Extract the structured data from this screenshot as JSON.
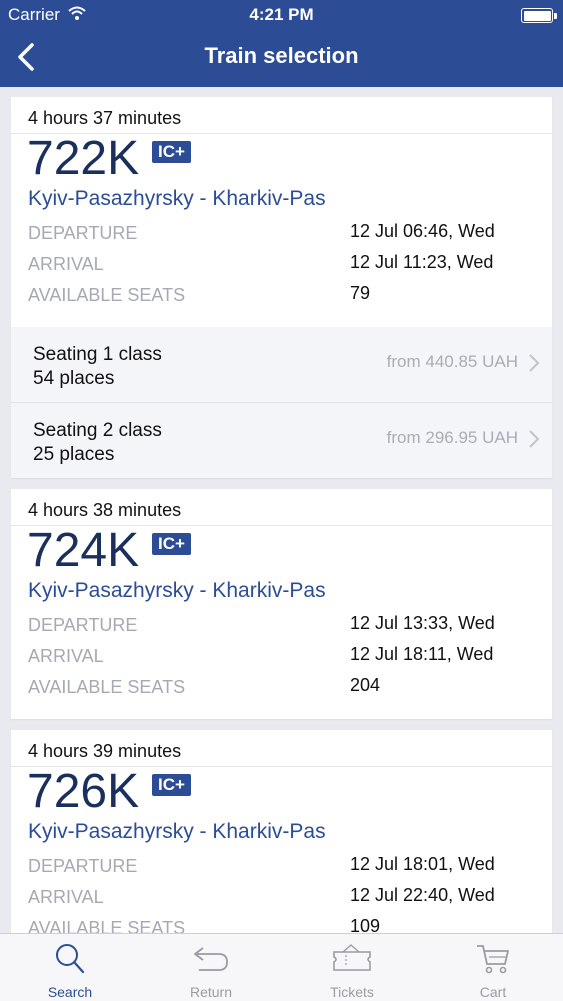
{
  "status_bar": {
    "carrier": "Carrier",
    "time": "4:21 PM"
  },
  "nav": {
    "title": "Train selection"
  },
  "trains": [
    {
      "duration": "4 hours 37 minutes",
      "number": "722K",
      "badge": "IC+",
      "route": "Kyiv-Pasazhyrsky - Kharkiv-Pas",
      "departure_label": "DEPARTURE",
      "departure": "12 Jul 06:46, Wed",
      "arrival_label": "ARRIVAL",
      "arrival": "12 Jul 11:23, Wed",
      "seats_label": "AVAILABLE SEATS",
      "seats": "79",
      "classes": [
        {
          "name": "Seating 1 class",
          "places": "54 places",
          "price": "from 440.85 UAH"
        },
        {
          "name": "Seating 2 class",
          "places": "25 places",
          "price": "from 296.95 UAH"
        }
      ]
    },
    {
      "duration": "4 hours 38 minutes",
      "number": "724K",
      "badge": "IC+",
      "route": "Kyiv-Pasazhyrsky - Kharkiv-Pas",
      "departure_label": "DEPARTURE",
      "departure": "12 Jul 13:33, Wed",
      "arrival_label": "ARRIVAL",
      "arrival": "12 Jul 18:11, Wed",
      "seats_label": "AVAILABLE SEATS",
      "seats": "204"
    },
    {
      "duration": "4 hours 39 minutes",
      "number": "726K",
      "badge": "IC+",
      "route": "Kyiv-Pasazhyrsky - Kharkiv-Pas",
      "departure_label": "DEPARTURE",
      "departure": "12 Jul 18:01, Wed",
      "arrival_label": "ARRIVAL",
      "arrival": "12 Jul 22:40, Wed",
      "seats_label": "AVAILABLE SEATS",
      "seats": "109"
    }
  ],
  "tabs": [
    {
      "label": "Search",
      "icon": "search-icon",
      "active": true
    },
    {
      "label": "Return",
      "icon": "return-icon"
    },
    {
      "label": "Tickets",
      "icon": "ticket-icon"
    },
    {
      "label": "Cart",
      "icon": "cart-icon"
    }
  ],
  "colors": {
    "accent": "#2c4d96",
    "background": "#e9eaef",
    "muted": "#a5a9b3"
  }
}
